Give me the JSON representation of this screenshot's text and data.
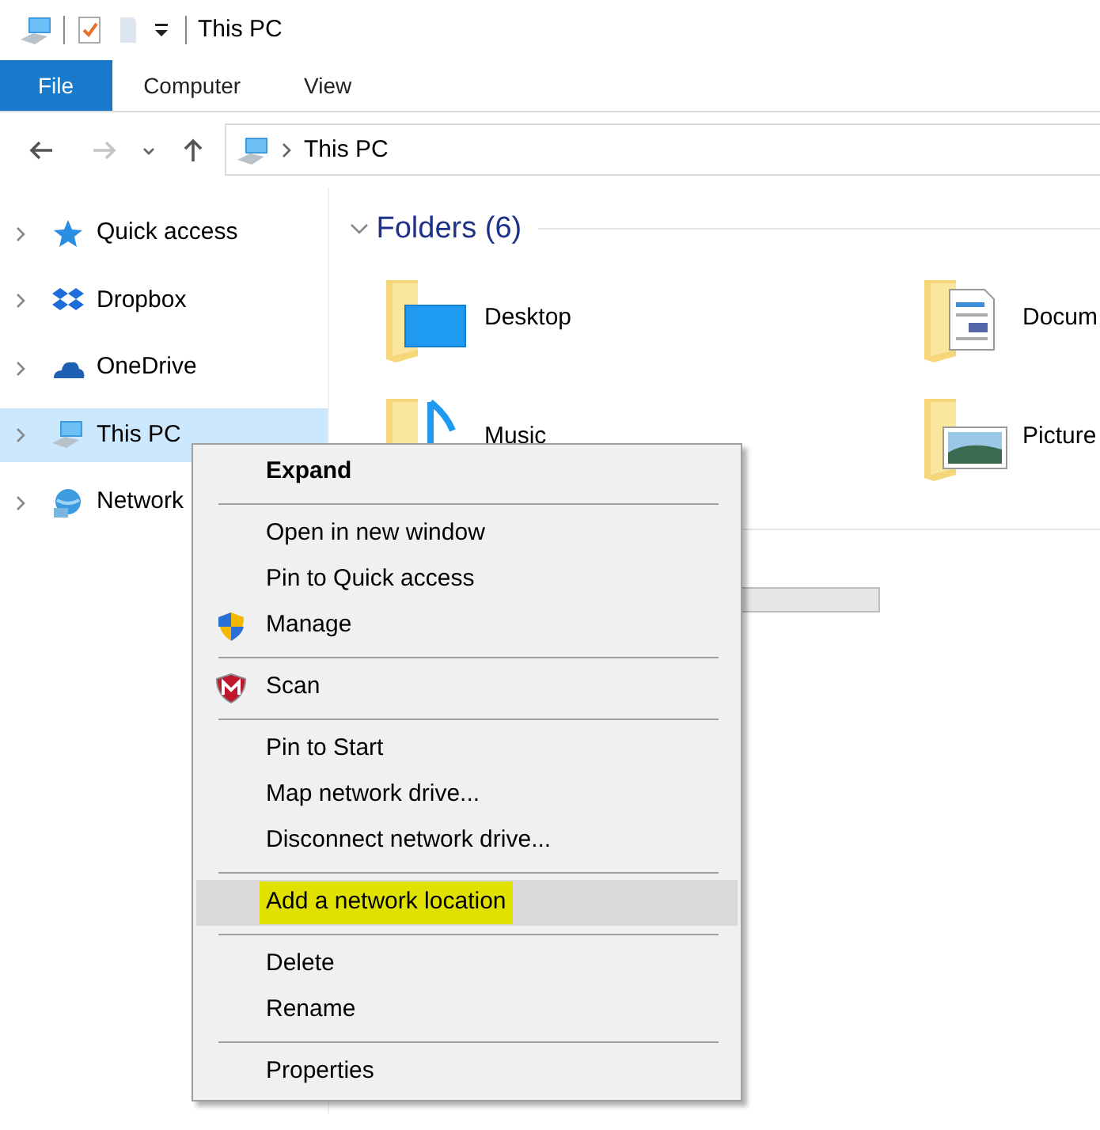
{
  "title_bar": {
    "title": "This PC"
  },
  "ribbon_tabs": [
    {
      "label": "File",
      "selected": true
    },
    {
      "label": "Computer",
      "selected": false
    },
    {
      "label": "View",
      "selected": false
    }
  ],
  "address_bar": {
    "path": "This PC"
  },
  "sidebar": {
    "items": [
      {
        "label": "Quick access",
        "kind": "star",
        "selected": false
      },
      {
        "label": "Dropbox",
        "kind": "dropbox",
        "selected": false
      },
      {
        "label": "OneDrive",
        "kind": "cloud",
        "selected": false
      },
      {
        "label": "This PC",
        "kind": "computer",
        "selected": true
      },
      {
        "label": "Network",
        "kind": "network",
        "selected": false
      }
    ]
  },
  "folders_group": {
    "title": "Folders (6)",
    "expanded": true,
    "items": [
      {
        "name": "Desktop",
        "kind": "desktop"
      },
      {
        "name": "Docum",
        "kind": "documents"
      },
      {
        "name": "Music",
        "kind": "music"
      },
      {
        "name": "Picture",
        "kind": "pictures"
      }
    ]
  },
  "context_menu": {
    "items": [
      {
        "kind": "item",
        "label": "Expand",
        "default": true,
        "selected": false
      },
      {
        "kind": "separator"
      },
      {
        "kind": "item",
        "label": "Open in new window",
        "selected": false
      },
      {
        "kind": "item",
        "label": "Pin to Quick access",
        "selected": false
      },
      {
        "kind": "admin",
        "label": "Manage",
        "selected": false
      },
      {
        "kind": "separator"
      },
      {
        "kind": "security",
        "label": "Scan",
        "selected": false
      },
      {
        "kind": "separator"
      },
      {
        "kind": "item",
        "label": "Pin to Start",
        "selected": false
      },
      {
        "kind": "item",
        "label": "Map network drive...",
        "selected": false
      },
      {
        "kind": "item",
        "label": "Disconnect network drive...",
        "selected": false
      },
      {
        "kind": "separator"
      },
      {
        "kind": "item",
        "label": "Add a network location",
        "selected": true,
        "highlighted": true
      },
      {
        "kind": "separator"
      },
      {
        "kind": "item",
        "label": "Delete",
        "selected": false
      },
      {
        "kind": "item",
        "label": "Rename",
        "selected": false
      },
      {
        "kind": "separator"
      },
      {
        "kind": "item",
        "label": "Properties",
        "selected": false
      }
    ]
  }
}
